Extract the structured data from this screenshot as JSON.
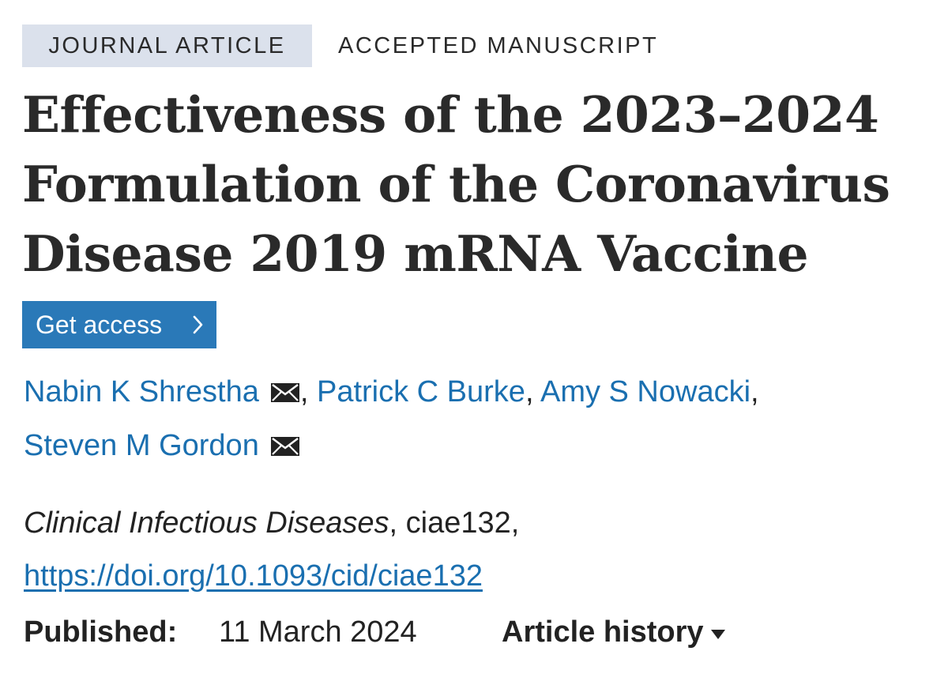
{
  "article": {
    "type_tag": "JOURNAL ARTICLE",
    "status_tag": "ACCEPTED MANUSCRIPT",
    "title": "Effectiveness of the 2023–2024 Formulation of the Coronavirus Disease 2019 mRNA Vaccine",
    "get_access_label": "Get access",
    "authors": [
      {
        "name": "Nabin K Shrestha",
        "email_icon": "envelope-icon"
      },
      {
        "name": "Patrick C Burke"
      },
      {
        "name": "Amy S Nowacki"
      },
      {
        "name": "Steven M Gordon",
        "email_icon": "envelope-icon"
      }
    ],
    "author_separator": ",",
    "citation": {
      "journal": "Clinical Infectious Diseases",
      "article_id": ", ciae132,",
      "doi": "https://doi.org/10.1093/cid/ciae132"
    },
    "published_label": "Published:",
    "published_date": "11 March 2024",
    "history_label": "Article history"
  },
  "colors": {
    "tag_background": "#dbe1ec",
    "button_blue": "#2a79b8",
    "link_blue": "#1a6fb0",
    "text": "#222222"
  },
  "icons": {
    "button_chevron": "chevron-right-icon",
    "history_caret": "caret-down-icon",
    "email": "envelope-icon"
  }
}
